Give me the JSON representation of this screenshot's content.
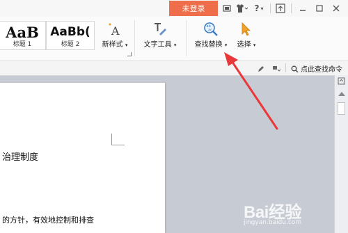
{
  "titlebar": {
    "login_label": "未登录",
    "help_label": "?"
  },
  "ribbon": {
    "styles": [
      {
        "preview": "AaB",
        "label": "标题 1"
      },
      {
        "preview": "AaBb(",
        "label": "标题 2"
      }
    ],
    "new_style": "新样式",
    "text_tool": "文字工具",
    "find_replace": "查找替换",
    "select": "选择"
  },
  "subbar": {
    "find_command": "点此查找命令"
  },
  "document": {
    "line1": "治理制度",
    "line2": "的方针，有效地控制和排查"
  },
  "watermark": {
    "main": "Bai经验",
    "sub": "jingyan.baidu.com"
  },
  "colors": {
    "login_bg": "#ee6d4a",
    "arrow": "#e8383a",
    "workspace": "#c7cbd3"
  }
}
